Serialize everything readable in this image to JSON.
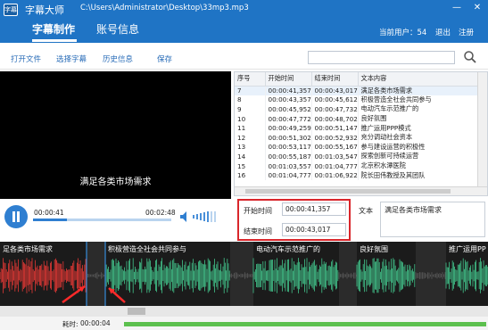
{
  "window": {
    "logo": "字幕",
    "app_name": "字幕大师",
    "file_path": "C:\\Users\\Administrator\\Desktop\\33mp3.mp3",
    "controls": {
      "minimize": "—",
      "close": "✕"
    }
  },
  "tabs": [
    {
      "label": "字幕制作",
      "active": true
    },
    {
      "label": "账号信息",
      "active": false
    }
  ],
  "header_right": {
    "online_users": "当前用户：54",
    "logout": "退出",
    "register": "注册"
  },
  "toolbar": {
    "open_file": "打开文件",
    "select_subtitles": "选择字幕",
    "history": "历史信息",
    "save": "保存"
  },
  "search": {
    "value": ""
  },
  "video": {
    "current_subtitle": "满足各类市场需求"
  },
  "player": {
    "current_time": "00:00:41",
    "duration": "00:02:48",
    "progress": 0.244
  },
  "subtitle_table": {
    "columns": [
      "序号",
      "开始时间",
      "结束时间",
      "文本内容"
    ],
    "rows": [
      {
        "index": "7",
        "start": "00:00:41,357",
        "end": "00:00:43,017",
        "text": "满足各类市场需求",
        "selected": true
      },
      {
        "index": "8",
        "start": "00:00:43,357",
        "end": "00:00:45,612",
        "text": "积极营造全社会共同参与",
        "selected": false
      },
      {
        "index": "9",
        "start": "00:00:45,952",
        "end": "00:00:47,732",
        "text": "电动汽车示范推广的",
        "selected": false
      },
      {
        "index": "10",
        "start": "00:00:47,772",
        "end": "00:00:48,702",
        "text": "良好氛围",
        "selected": false
      },
      {
        "index": "11",
        "start": "00:00:49,259",
        "end": "00:00:51,147",
        "text": "推广运用PPP模式",
        "selected": false
      },
      {
        "index": "12",
        "start": "00:00:51,302",
        "end": "00:00:52,932",
        "text": "充分调动社会资本",
        "selected": false
      },
      {
        "index": "13",
        "start": "00:00:53,117",
        "end": "00:00:55,167",
        "text": "参与建设运营的积极性",
        "selected": false
      },
      {
        "index": "14",
        "start": "00:00:55,187",
        "end": "00:01:03,547",
        "text": "探索创新可持续运营",
        "selected": false
      },
      {
        "index": "15",
        "start": "00:01:03,557",
        "end": "00:01:04,777",
        "text": "北京积水潭医院",
        "selected": false
      },
      {
        "index": "16",
        "start": "00:01:04,777",
        "end": "00:01:06,922",
        "text": "院长田伟教授及其团队",
        "selected": false
      }
    ]
  },
  "editor": {
    "start_label": "开始时间",
    "start_value": "00:00:41,357",
    "end_label": "结束时间",
    "end_value": "00:00:43,017",
    "text_label": "文本",
    "text_value": "满足各类市场需求"
  },
  "waveform": {
    "segments": [
      {
        "label": "足各类市场需求",
        "selected": true
      },
      {
        "label": "积极营造全社会共同参与",
        "selected": false
      },
      {
        "label": "电动汽车示范推广的",
        "selected": false
      },
      {
        "label": "良好氛围",
        "selected": false
      },
      {
        "label": "推广运用PP",
        "selected": false
      }
    ]
  },
  "status": {
    "elapsed_label": "耗时:",
    "elapsed_value": "00:00:04",
    "progress": 1.0
  },
  "colors": {
    "title_bar": "#1f74c5",
    "accent": "#2f7fd1",
    "link": "#2a6db8",
    "highlight_box": "#d9262b",
    "wave_selected": "#e53935",
    "wave_normal": "#43c58c",
    "wave_background": "#2b2b2b",
    "status_bar": "#5cc04e"
  }
}
